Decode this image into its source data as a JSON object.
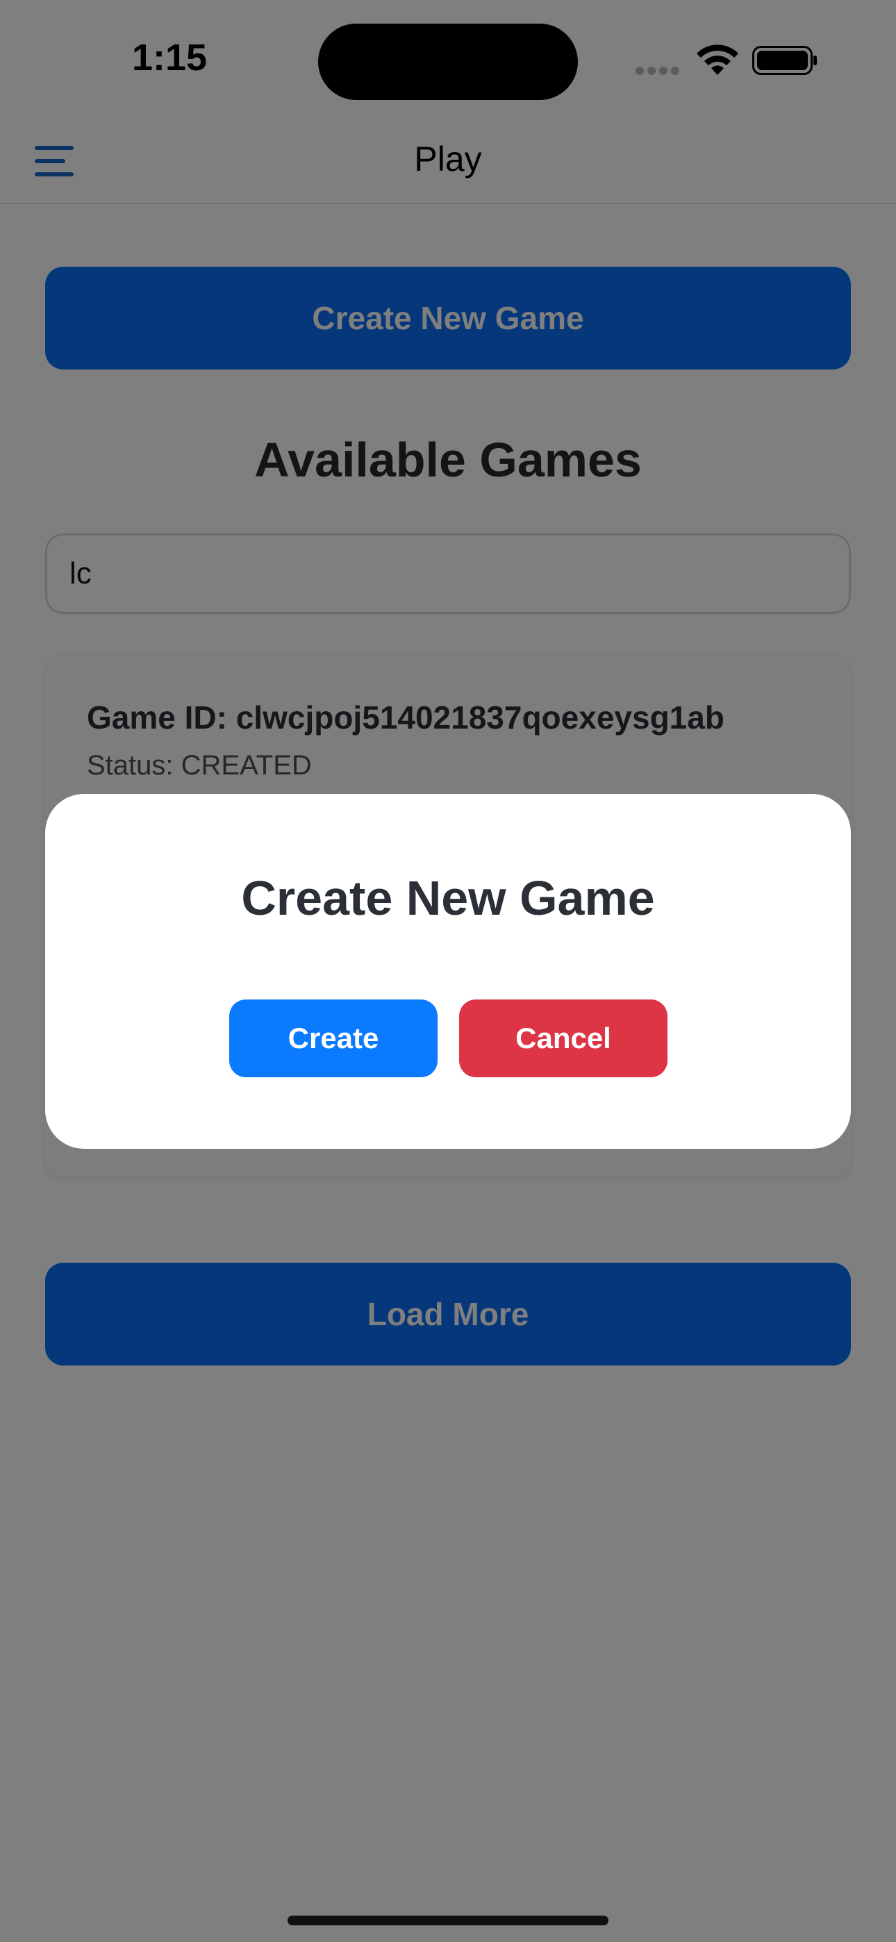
{
  "status_bar": {
    "time": "1:15",
    "icons": [
      "cellular-dots-icon",
      "wifi-icon",
      "battery-icon"
    ]
  },
  "nav": {
    "title": "Play",
    "menu_icon": "hamburger-menu-icon"
  },
  "main": {
    "create_button_label": "Create New Game",
    "section_title": "Available Games",
    "search_value": "lc",
    "games": [
      {
        "id_text": "Game ID: clwcjpoj514021837qoexeysg1ab",
        "status_text": "Status: CREATED"
      }
    ],
    "load_more_label": "Load More"
  },
  "modal": {
    "title": "Create New Game",
    "create_label": "Create",
    "cancel_label": "Cancel"
  },
  "colors": {
    "primary": "#0a6ef5",
    "modal_create": "#0a7bff",
    "danger": "#dd3545",
    "menu_icon": "#1a66c9"
  }
}
